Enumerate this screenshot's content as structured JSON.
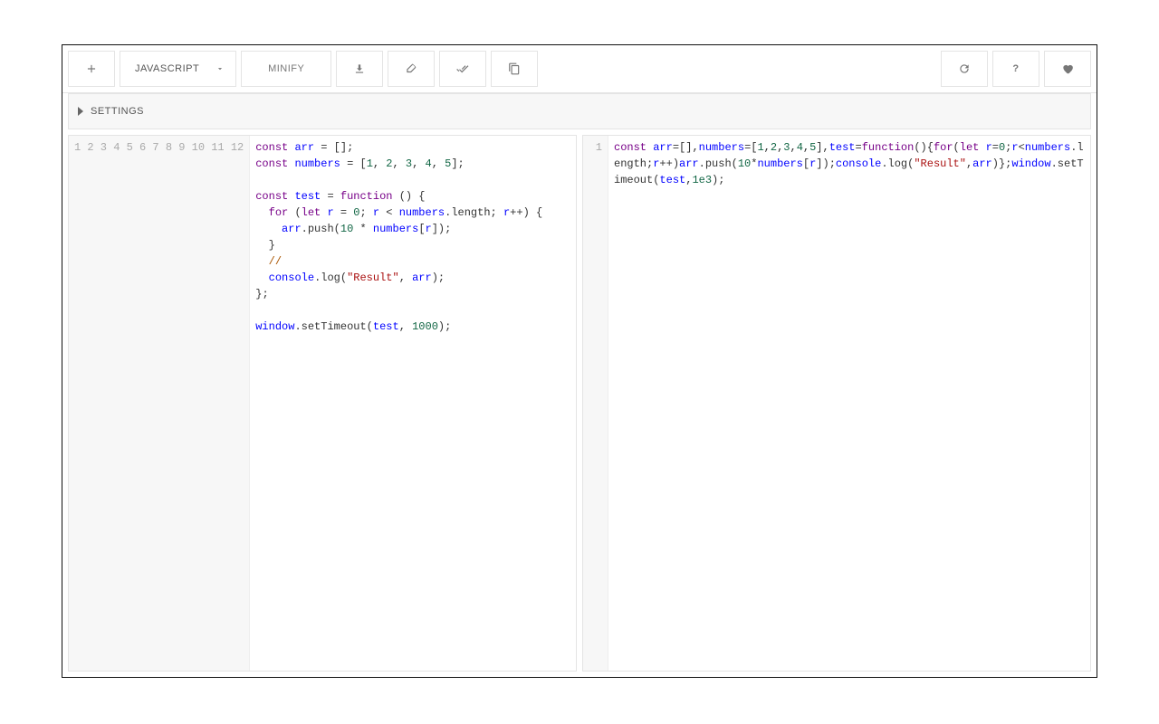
{
  "toolbar": {
    "language": "JAVASCRIPT",
    "action": "MINIFY",
    "settings_label": "SETTINGS"
  },
  "left_editor": {
    "line_count": 12,
    "code_lines": [
      "const arr = [];",
      "const numbers = [1, 2, 3, 4, 5];",
      "",
      "const test = function () {",
      "  for (let r = 0; r < numbers.length; r++) {",
      "    arr.push(10 * numbers[r]);",
      "  }",
      "  //",
      "  console.log(\"Result\", arr);",
      "};",
      "",
      "window.setTimeout(test, 1000);"
    ]
  },
  "right_editor": {
    "line_count": 1,
    "code": "const arr=[],numbers=[1,2,3,4,5],test=function(){for(let r=0;r<numbers.length;r++)arr.push(10*numbers[r]);console.log(\"Result\",arr)};window.setTimeout(test,1e3);"
  }
}
